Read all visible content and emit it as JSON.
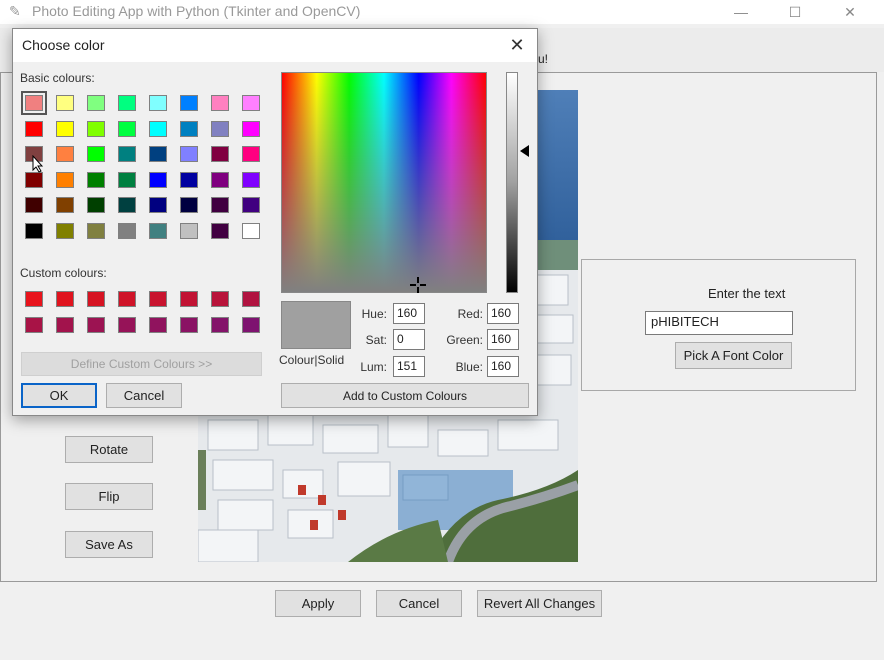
{
  "window": {
    "title": "Photo Editing App with Python (Tkinter and OpenCV)",
    "minimize_glyph": "—",
    "maximize_glyph": "☐",
    "close_glyph": "✕"
  },
  "tab_fragment": "u!",
  "left_buttons": {
    "rotate": "Rotate",
    "flip": "Flip",
    "save_as": "Save As"
  },
  "text_panel": {
    "label": "Enter the text",
    "entry_value": "pHIBITECH",
    "font_color_button": "Pick A Font Color"
  },
  "bottom_buttons": {
    "apply": "Apply",
    "cancel": "Cancel",
    "revert": "Revert All Changes"
  },
  "color_dialog": {
    "title": "Choose color",
    "close_glyph": "✕",
    "basic_colours_label": "Basic colours:",
    "custom_colours_label": "Custom colours:",
    "define_custom_button": "Define Custom Colours >>",
    "ok_button": "OK",
    "cancel_button": "Cancel",
    "add_custom_button": "Add to Custom Colours",
    "colour_solid_label": "Colour|Solid",
    "hue_label": "Hue:",
    "sat_label": "Sat:",
    "lum_label": "Lum:",
    "red_label": "Red:",
    "green_label": "Green:",
    "blue_label": "Blue:",
    "hue": "160",
    "sat": "0",
    "lum": "151",
    "red": "160",
    "green": "160",
    "blue": "160",
    "preview_color": "#a0a0a0",
    "basic_colours": [
      [
        "#f08080",
        "#ffff80",
        "#80ff80",
        "#00ff80",
        "#80ffff",
        "#0080ff",
        "#ff80c0",
        "#ff80ff"
      ],
      [
        "#ff0000",
        "#ffff00",
        "#80ff00",
        "#00ff40",
        "#00ffff",
        "#0080c0",
        "#8080c0",
        "#ff00ff"
      ],
      [
        "#804040",
        "#ff8040",
        "#00ff00",
        "#008080",
        "#004080",
        "#8080ff",
        "#800040",
        "#ff0080"
      ],
      [
        "#800000",
        "#ff8000",
        "#008000",
        "#008040",
        "#0000ff",
        "#0000a0",
        "#800080",
        "#8000ff"
      ],
      [
        "#400000",
        "#804000",
        "#004000",
        "#004040",
        "#000080",
        "#000040",
        "#400040",
        "#400080"
      ],
      [
        "#000000",
        "#808000",
        "#808040",
        "#808080",
        "#408080",
        "#c0c0c0",
        "#400040",
        "#ffffff"
      ]
    ],
    "custom_colours": [
      [
        "#e8131c",
        "#e0131e",
        "#d61322",
        "#cf1328",
        "#c8132e",
        "#c11334",
        "#b8133a",
        "#b01340"
      ],
      [
        "#a81346",
        "#a2134c",
        "#9c1352",
        "#961358",
        "#90135e",
        "#8a1364",
        "#84136a",
        "#7e1370"
      ]
    ]
  }
}
